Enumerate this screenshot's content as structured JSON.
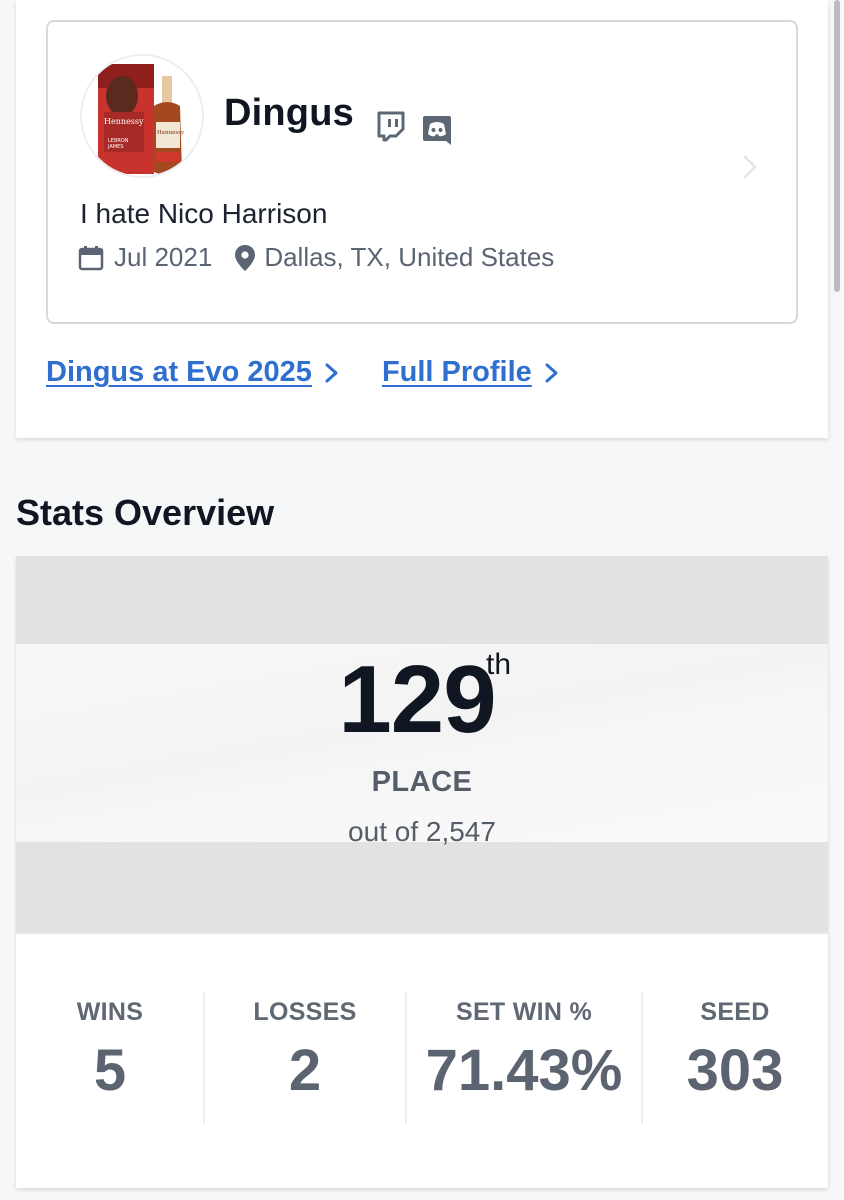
{
  "profile": {
    "username": "Dingus",
    "bio": "I hate Nico Harrison",
    "joined": "Jul 2021",
    "location": "Dallas, TX, United States",
    "icons": {
      "twitch": "twitch-icon",
      "discord": "discord-icon",
      "calendar": "calendar-icon",
      "location": "location-pin-icon"
    }
  },
  "links": {
    "event_link": "Dingus at Evo 2025",
    "full_profile": "Full Profile"
  },
  "stats": {
    "section_title": "Stats Overview",
    "placement": {
      "number": "129",
      "suffix": "th",
      "label": "PLACE",
      "total": "out of 2,547"
    },
    "items": [
      {
        "label": "WINS",
        "value": "5"
      },
      {
        "label": "LOSSES",
        "value": "2"
      },
      {
        "label": "SET WIN %",
        "value": "71.43%"
      },
      {
        "label": "SEED",
        "value": "303"
      }
    ]
  },
  "colors": {
    "link": "#2f6fd0",
    "text_dark": "#111722",
    "text_muted": "#5b6472",
    "placement_bg": "#e2e2e2"
  }
}
